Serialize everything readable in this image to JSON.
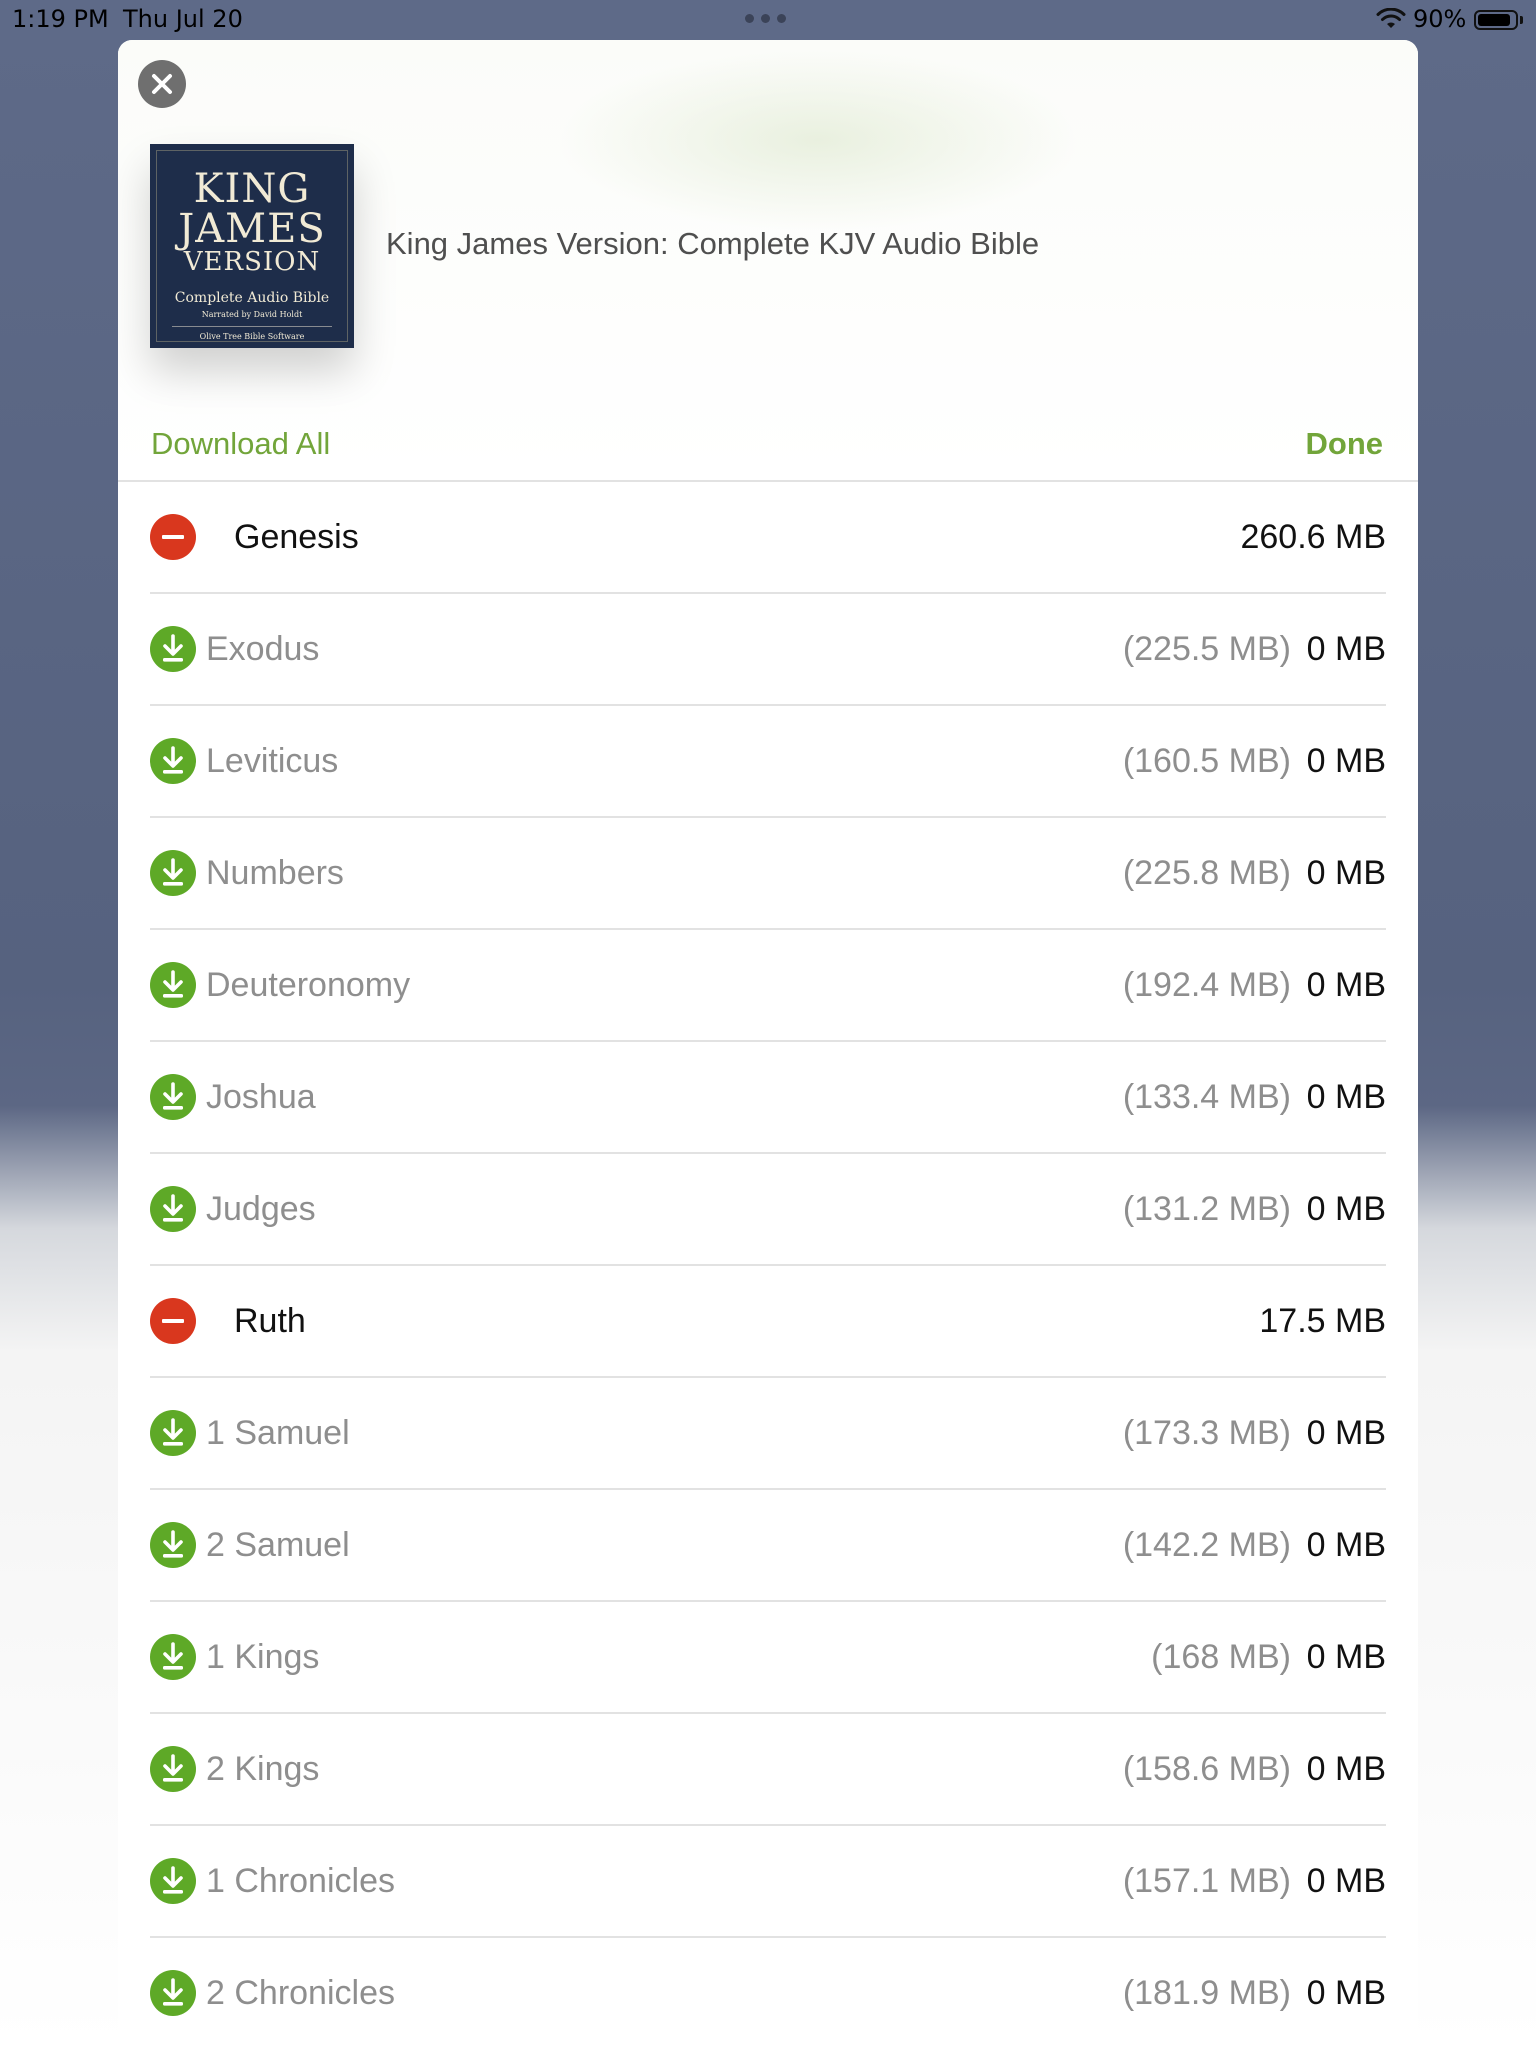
{
  "status_bar": {
    "time": "1:19 PM",
    "date": "Thu Jul 20",
    "battery_percent": "90%",
    "battery_level": 0.9,
    "wifi_icon": "wifi-icon"
  },
  "header": {
    "close_icon": "close-icon",
    "cover": {
      "line1": "KING",
      "line2": "JAMES",
      "line3": "VERSION",
      "subtitle": "Complete Audio Bible",
      "narrator": "Narrated by David Holdt",
      "publisher": "Olive Tree Bible Software",
      "background_color": "#1e2d4a"
    },
    "title": "King James Version: Complete KJV Audio Bible",
    "download_all_label": "Download All",
    "done_label": "Done",
    "accent_color": "#72a53a"
  },
  "books": [
    {
      "name": "Genesis",
      "status": "downloaded",
      "full_size": "",
      "size": "260.6 MB"
    },
    {
      "name": "Exodus",
      "status": "not-downloaded",
      "full_size": "(225.5 MB)",
      "size": "0 MB"
    },
    {
      "name": "Leviticus",
      "status": "not-downloaded",
      "full_size": "(160.5 MB)",
      "size": "0 MB"
    },
    {
      "name": "Numbers",
      "status": "not-downloaded",
      "full_size": "(225.8 MB)",
      "size": "0 MB"
    },
    {
      "name": "Deuteronomy",
      "status": "not-downloaded",
      "full_size": "(192.4 MB)",
      "size": "0 MB"
    },
    {
      "name": "Joshua",
      "status": "not-downloaded",
      "full_size": "(133.4 MB)",
      "size": "0 MB"
    },
    {
      "name": "Judges",
      "status": "not-downloaded",
      "full_size": "(131.2 MB)",
      "size": "0 MB"
    },
    {
      "name": "Ruth",
      "status": "downloaded",
      "full_size": "",
      "size": "17.5 MB"
    },
    {
      "name": "1 Samuel",
      "status": "not-downloaded",
      "full_size": "(173.3 MB)",
      "size": "0 MB"
    },
    {
      "name": "2 Samuel",
      "status": "not-downloaded",
      "full_size": "(142.2 MB)",
      "size": "0 MB"
    },
    {
      "name": "1 Kings",
      "status": "not-downloaded",
      "full_size": "(168 MB)",
      "size": "0 MB"
    },
    {
      "name": "2 Kings",
      "status": "not-downloaded",
      "full_size": "(158.6 MB)",
      "size": "0 MB"
    },
    {
      "name": "1 Chronicles",
      "status": "not-downloaded",
      "full_size": "(157.1 MB)",
      "size": "0 MB"
    },
    {
      "name": "2 Chronicles",
      "status": "not-downloaded",
      "full_size": "(181.9 MB)",
      "size": "0 MB"
    }
  ],
  "icons": {
    "downloaded": "remove-icon",
    "not_downloaded": "download-icon"
  },
  "colors": {
    "download_green": "#5ea927",
    "delete_red": "#d9371e"
  }
}
